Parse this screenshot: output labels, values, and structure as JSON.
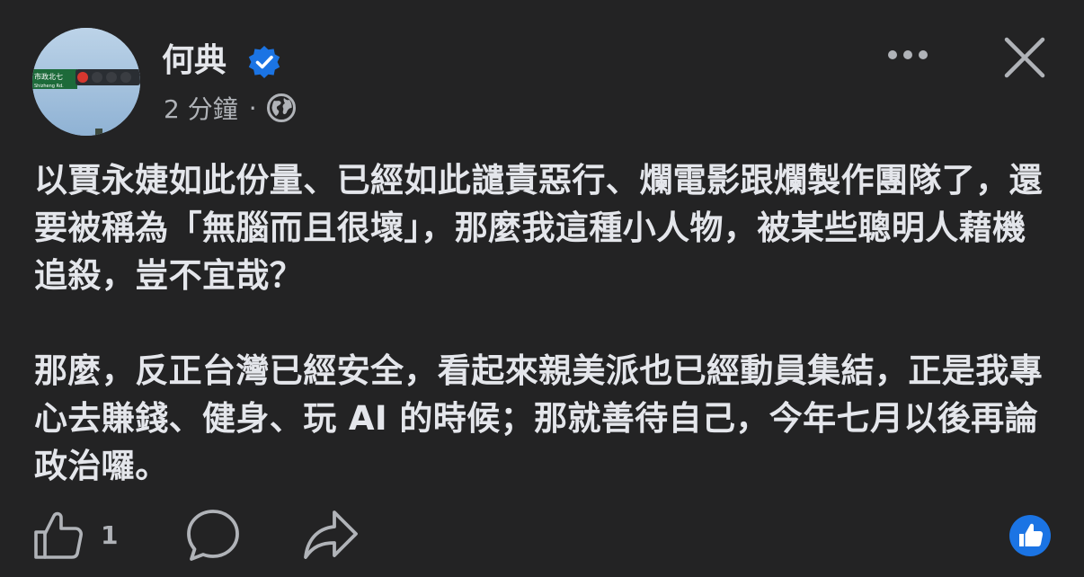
{
  "author": {
    "name": "何典",
    "verified": true,
    "avatar_icon": "traffic-light-photo",
    "sign_text": "市政北七",
    "sign_subtext": "Shizheng Rd."
  },
  "meta": {
    "timestamp": "2 分鐘",
    "separator": "·",
    "audience_icon": "globe-icon"
  },
  "header_actions": {
    "more_icon": "more-options-icon",
    "close_icon": "close-icon"
  },
  "post": {
    "paragraphs": [
      "以賈永婕如此份量、已經如此譴責惡行、爛電影跟爛製作團隊了，還要被稱為「無腦而且很壞」，那麼我這種小人物，被某些聰明人藉機追殺，豈不宜哉？",
      "那麼，反正台灣已經安全，看起來親美派也已經動員集結，正是我專心去賺錢、健身、玩 AI 的時候；那就善待自己，今年七月以後再論政治囉。"
    ]
  },
  "actions": {
    "like_count": "1",
    "like_icon": "thumbs-up-icon",
    "comment_icon": "comment-icon",
    "share_icon": "share-icon",
    "reaction_icon": "like-reaction-icon"
  },
  "colors": {
    "background": "#232324",
    "text": "#e4e6eb",
    "secondary": "#b0b3b8",
    "accent": "#1b74e4"
  }
}
